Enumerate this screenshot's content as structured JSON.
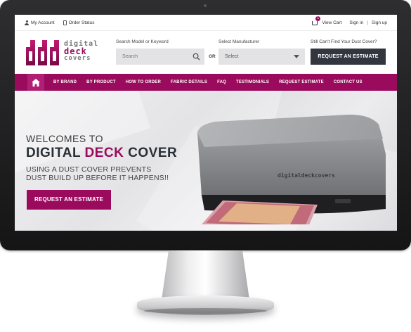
{
  "topbar": {
    "my_account": "My Account",
    "order_status": "Order Status",
    "cart_count": "1",
    "view_cart": "View Cart",
    "sign_in": "Sign in",
    "divider": "|",
    "sign_up": "Sign up"
  },
  "logo": {
    "line1": "digital",
    "line2": "deck",
    "line3": "covers"
  },
  "search": {
    "label": "Search Model or Keyword",
    "placeholder": "Search"
  },
  "or_text": "OR",
  "manufacturer": {
    "label": "Select Manufacturer",
    "selected": "Select"
  },
  "estimate": {
    "prompt": "Still Can't Find Your Dust Cover?",
    "button": "REQUEST AN ESTIMATE"
  },
  "nav": {
    "items": [
      "BY BRAND",
      "BY PRODUCT",
      "HOW TO ORDER",
      "FABRIC DETAILS",
      "FAQ",
      "TESTIMONIALS",
      "REQUEST ESTIMATE",
      "CONTACT US"
    ]
  },
  "hero": {
    "welcome": "WELCOMES TO",
    "title_part1": "DIGITAL ",
    "title_highlight": "DECK",
    "title_part2": " COVER",
    "tagline": "USING A DUST COVER PREVENTS DUST BUILD UP BEFORE IT HAPPENS!!",
    "button": "REQUEST AN ESTIMATE",
    "cover_label": "digitaldeckcovers"
  },
  "colors": {
    "brand": "#9b0b5d",
    "dark_button": "#31363f"
  }
}
